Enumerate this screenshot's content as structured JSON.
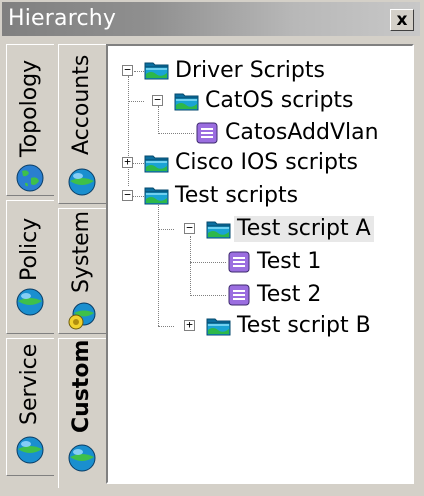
{
  "window": {
    "title": "Hierarchy",
    "close_label": "x"
  },
  "tabs": {
    "topology": {
      "label": "Topology",
      "icon": "globe-icon"
    },
    "accounts": {
      "label": "Accounts",
      "icon": "sphere-icon"
    },
    "policy": {
      "label": "Policy",
      "icon": "sphere-icon"
    },
    "system": {
      "label": "System",
      "icon": "system-icon"
    },
    "service": {
      "label": "Service",
      "icon": "sphere-icon"
    },
    "custom": {
      "label": "Custom",
      "icon": "sphere-icon",
      "active": true
    }
  },
  "tree": {
    "root": {
      "label": "Driver Scripts",
      "expander": "−"
    },
    "catos": {
      "label": "CatOS scripts",
      "expander": "−"
    },
    "catos_add_vlan": {
      "label": "CatosAddVlan"
    },
    "cisco_ios": {
      "label": "Cisco IOS scripts",
      "expander": "+"
    },
    "test_scripts": {
      "label": "Test scripts",
      "expander": "−"
    },
    "test_script_a": {
      "label": "Test script A",
      "expander": "−",
      "selected": true
    },
    "test1": {
      "label": "Test 1"
    },
    "test2": {
      "label": "Test 2"
    },
    "test_script_b": {
      "label": "Test script B",
      "expander": "+"
    }
  },
  "colors": {
    "folder_blue": "#1aa3d4",
    "folder_green": "#2db84a",
    "script_purple": "#9b6ee0"
  }
}
